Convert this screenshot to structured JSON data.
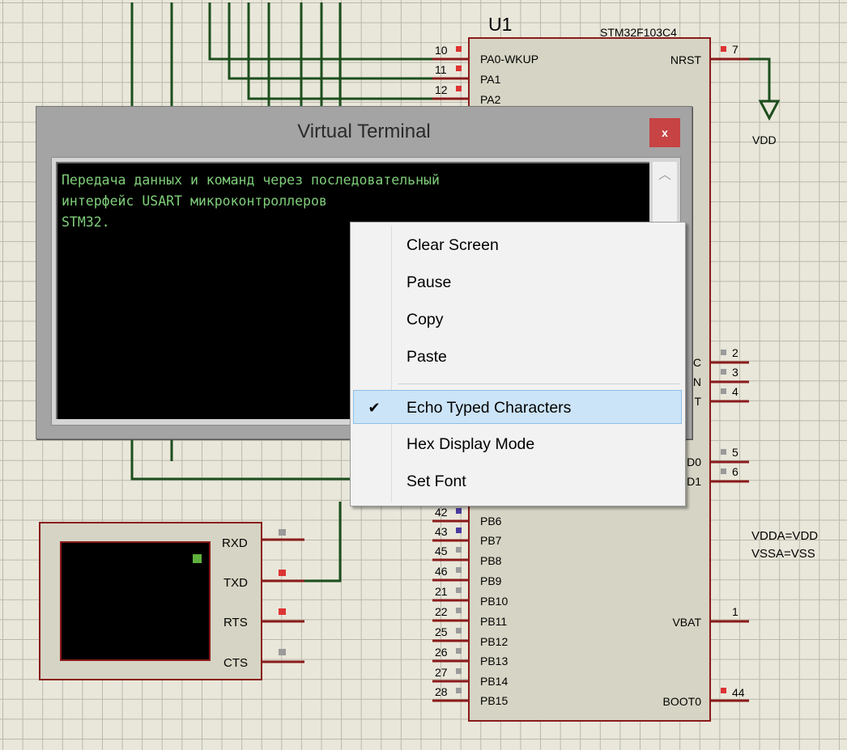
{
  "schematic": {
    "chip": {
      "ref": "U1",
      "part": "STM32F103C4",
      "left_pins": [
        {
          "num": "10",
          "name": "PA0-WKUP"
        },
        {
          "num": "11",
          "name": "PA1"
        },
        {
          "num": "12",
          "name": "PA2"
        },
        {
          "num": "42",
          "name": "PB6"
        },
        {
          "num": "43",
          "name": "PB7"
        },
        {
          "num": "45",
          "name": "PB8"
        },
        {
          "num": "46",
          "name": "PB9"
        },
        {
          "num": "21",
          "name": "PB10"
        },
        {
          "num": "22",
          "name": "PB11"
        },
        {
          "num": "25",
          "name": "PB12"
        },
        {
          "num": "26",
          "name": "PB13"
        },
        {
          "num": "27",
          "name": "PB14"
        },
        {
          "num": "28",
          "name": "PB15"
        }
      ],
      "right_pins": [
        {
          "num": "7",
          "name": "NRST"
        },
        {
          "num": "2",
          "name": "C"
        },
        {
          "num": "3",
          "name": "N"
        },
        {
          "num": "4",
          "name": "T"
        },
        {
          "num": "5",
          "name": "D0"
        },
        {
          "num": "6",
          "name": "D1"
        },
        {
          "num": "1",
          "name": "VBAT"
        },
        {
          "num": "44",
          "name": "BOOT0"
        }
      ],
      "power_note_1": "VDDA=VDD",
      "power_note_2": "VSSA=VSS",
      "vdd_label": "VDD"
    },
    "terminal_component": {
      "pins": [
        "RXD",
        "TXD",
        "RTS",
        "CTS"
      ]
    }
  },
  "terminal_window": {
    "title": "Virtual Terminal",
    "close_label": "x",
    "text": "Передача данных и команд через последовательный\nинтерфейс USART микроконтроллеров\nSTM32."
  },
  "context_menu": {
    "items": [
      {
        "label": "Clear Screen",
        "checked": false
      },
      {
        "label": "Pause",
        "checked": false
      },
      {
        "label": "Copy",
        "checked": false
      },
      {
        "label": "Paste",
        "checked": false
      },
      {
        "label": "Echo Typed Characters",
        "checked": true
      },
      {
        "label": "Hex Display Mode",
        "checked": false
      },
      {
        "label": "Set Font",
        "checked": false
      }
    ]
  },
  "colors": {
    "wire": "#1d4e1d",
    "pin": "#8a1b1b",
    "terminal_text": "#7fce7a",
    "menu_highlight": "#cce4f7"
  }
}
